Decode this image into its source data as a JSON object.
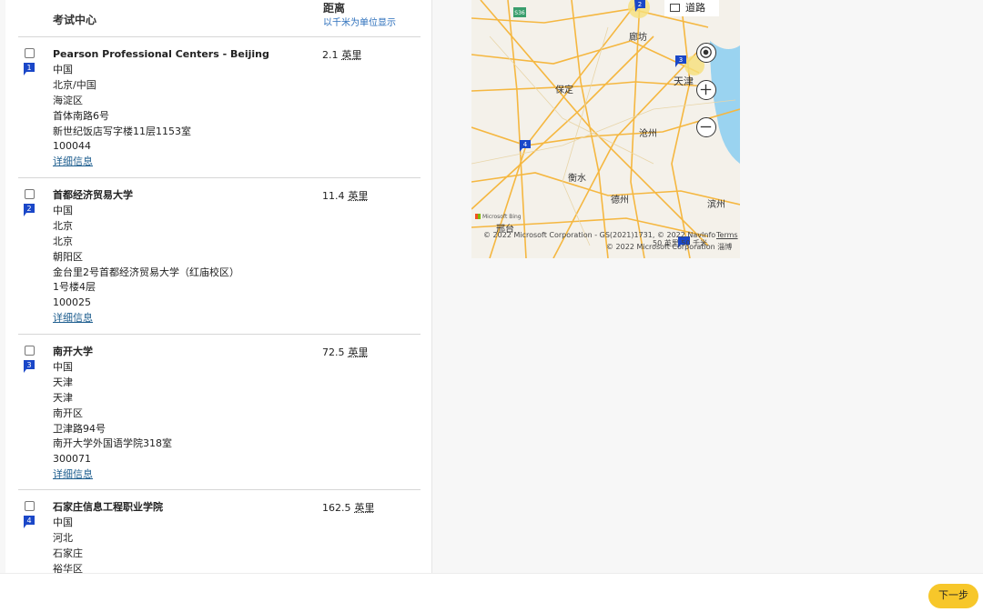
{
  "header": {
    "center_label": "考试中心",
    "distance_label": "距离",
    "distance_sub": "以千米为单位显示"
  },
  "centers": [
    {
      "number": "1",
      "distance": "2.1",
      "unit": "英里",
      "lines": [
        "Pearson Professional Centers - Beijing",
        "中国",
        "北京/中国",
        "海淀区",
        "首体南路6号",
        "新世纪饭店写字楼11层1153室",
        "100044"
      ],
      "link": "详细信息"
    },
    {
      "number": "2",
      "distance": "11.4",
      "unit": "英里",
      "lines": [
        "首都经济贸易大学",
        "中国",
        "北京",
        "北京",
        "朝阳区",
        "金台里2号首都经济贸易大学（红庙校区）",
        "1号楼4层",
        "100025"
      ],
      "link": "详细信息"
    },
    {
      "number": "3",
      "distance": "72.5",
      "unit": "英里",
      "lines": [
        "南开大学",
        "中国",
        "天津",
        "天津",
        "南开区",
        "卫津路94号",
        "南开大学外国语学院318室",
        "300071"
      ],
      "link": "详细信息"
    },
    {
      "number": "4",
      "distance": "162.5",
      "unit": "英里",
      "lines": [
        "石家庄信息工程职业学院",
        "中国",
        "河北",
        "石家庄",
        "裕华区"
      ],
      "link": ""
    }
  ],
  "map": {
    "road_toggle": "道路",
    "cities": [
      "廊坊",
      "保定",
      "天津",
      "沧州",
      "衡水",
      "邢台",
      "德州",
      "滨州"
    ],
    "highway": "S36",
    "attribution1": "© 2022 Microsoft Corporation - GS(2021)1731, © 2022 NavInfo",
    "terms": "Terms",
    "attribution2": "© 2022 Microsoft Corporation 淄博",
    "scale": "50 英里",
    "scale2": "50 千米",
    "bing": "Microsoft Bing"
  },
  "footer": {
    "next_label": "下一步"
  },
  "colors": {
    "pin": "#1a47c8",
    "button": "#f7c72a",
    "link": "#1e5e8f",
    "road": "#f5b740",
    "water": "#9ad3f0"
  }
}
